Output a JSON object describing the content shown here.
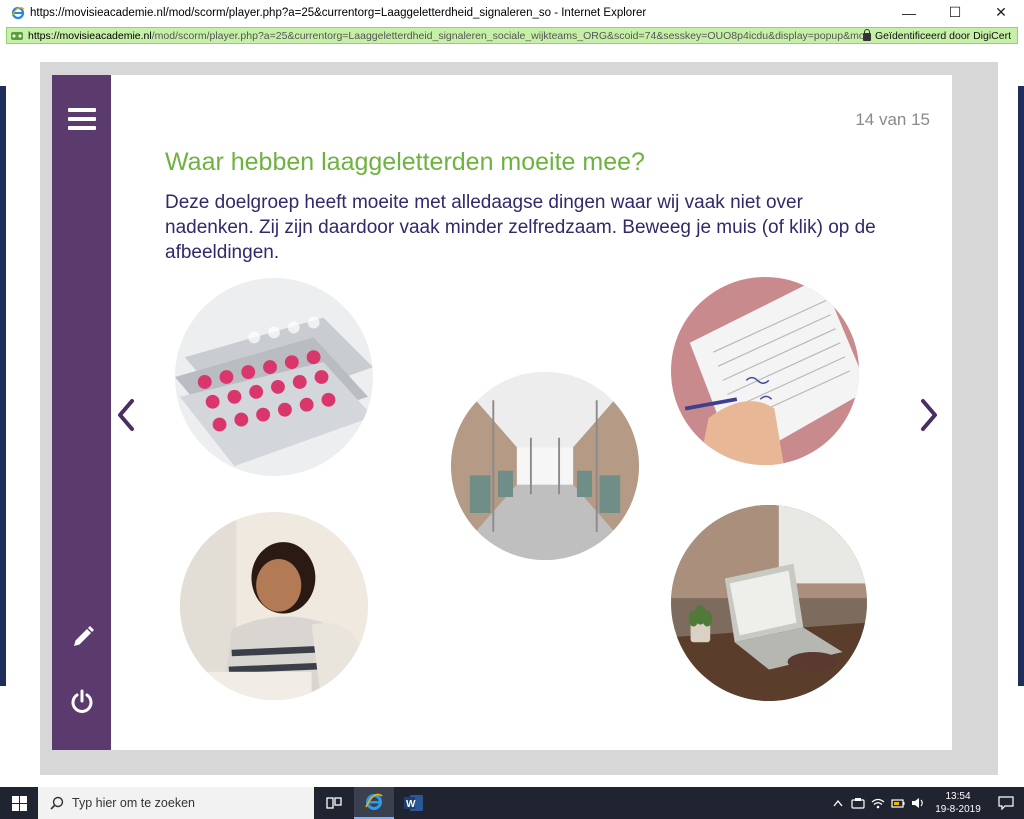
{
  "window": {
    "title": "https://movisieacademie.nl/mod/scorm/player.php?a=25&currentorg=Laaggeletterdheid_signaleren_so - Internet Explorer",
    "minimize": "—",
    "maximize": "☐",
    "close": "✕"
  },
  "address": {
    "host": "https://movisieacademie.nl",
    "path": "/mod/scorm/player.php?a=25&currentorg=Laaggeletterdheid_signaleren_sociale_wijkteams_ORG&scoid=74&sesskey=OUO8p4icdu&display=popup&mode=normal",
    "certificate": "Geïdentificeerd door DigiCert"
  },
  "slide": {
    "counter": "14 van 15",
    "heading": "Waar hebben laaggeletterden moeite mee?",
    "intro": "Deze doelgroep heeft moeite met alledaagse dingen waar wij vaak niet over nadenken. Zij zijn daardoor vaak minder zelfredzaam. Beweeg je muis (of klik) op de afbeeldingen."
  },
  "icons": {
    "menu": "hamburger-menu-icon",
    "edit": "pencil-icon",
    "exit": "power-icon",
    "prev": "chevron-left-icon",
    "next": "chevron-right-icon"
  },
  "images": [
    "medicine-blister-packs",
    "filling-in-form",
    "train-interior",
    "woman-studying",
    "laptop-on-desk"
  ],
  "taskbar": {
    "search_placeholder": "Typ hier om te zoeken",
    "time": "13:54",
    "date": "19-8-2019"
  },
  "colors": {
    "sidebar": "#5b3a6e",
    "heading": "#6db33f",
    "body_text": "#2f2a6b",
    "address_bar": "#c6f0a8"
  }
}
